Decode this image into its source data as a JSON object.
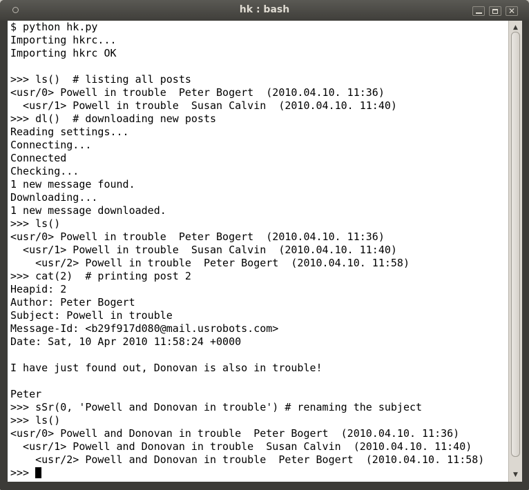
{
  "window": {
    "title": "hk : bash"
  },
  "titlebar_buttons": {
    "minimize": "minimize",
    "maximize": "maximize",
    "close": "✕"
  },
  "terminal": {
    "lines": [
      "$ python hk.py",
      "Importing hkrc...",
      "Importing hkrc OK",
      "",
      ">>> ls()  # listing all posts",
      "<usr/0> Powell in trouble  Peter Bogert  (2010.04.10. 11:36)",
      "  <usr/1> Powell in trouble  Susan Calvin  (2010.04.10. 11:40)",
      ">>> dl()  # downloading new posts",
      "Reading settings...",
      "Connecting...",
      "Connected",
      "Checking...",
      "1 new message found.",
      "Downloading...",
      "1 new message downloaded.",
      ">>> ls()",
      "<usr/0> Powell in trouble  Peter Bogert  (2010.04.10. 11:36)",
      "  <usr/1> Powell in trouble  Susan Calvin  (2010.04.10. 11:40)",
      "    <usr/2> Powell in trouble  Peter Bogert  (2010.04.10. 11:58)",
      ">>> cat(2)  # printing post 2",
      "Heapid: 2",
      "Author: Peter Bogert",
      "Subject: Powell in trouble",
      "Message-Id: <b29f917d080@mail.usrobots.com>",
      "Date: Sat, 10 Apr 2010 11:58:24 +0000",
      "",
      "I have just found out, Donovan is also in trouble!",
      "",
      "Peter",
      ">>> sSr(0, 'Powell and Donovan in trouble') # renaming the subject",
      ">>> ls()",
      "<usr/0> Powell and Donovan in trouble  Peter Bogert  (2010.04.10. 11:36)",
      "  <usr/1> Powell and Donovan in trouble  Susan Calvin  (2010.04.10. 11:40)",
      "    <usr/2> Powell and Donovan in trouble  Peter Bogert  (2010.04.10. 11:58)"
    ],
    "prompt": ">>> "
  },
  "scrollbar": {
    "up_icon": "arrow-up-icon",
    "down_icon": "arrow-down-icon"
  },
  "colors": {
    "titlebar": "#3c3b37",
    "terminal_bg": "#ffffff",
    "terminal_fg": "#000000"
  }
}
